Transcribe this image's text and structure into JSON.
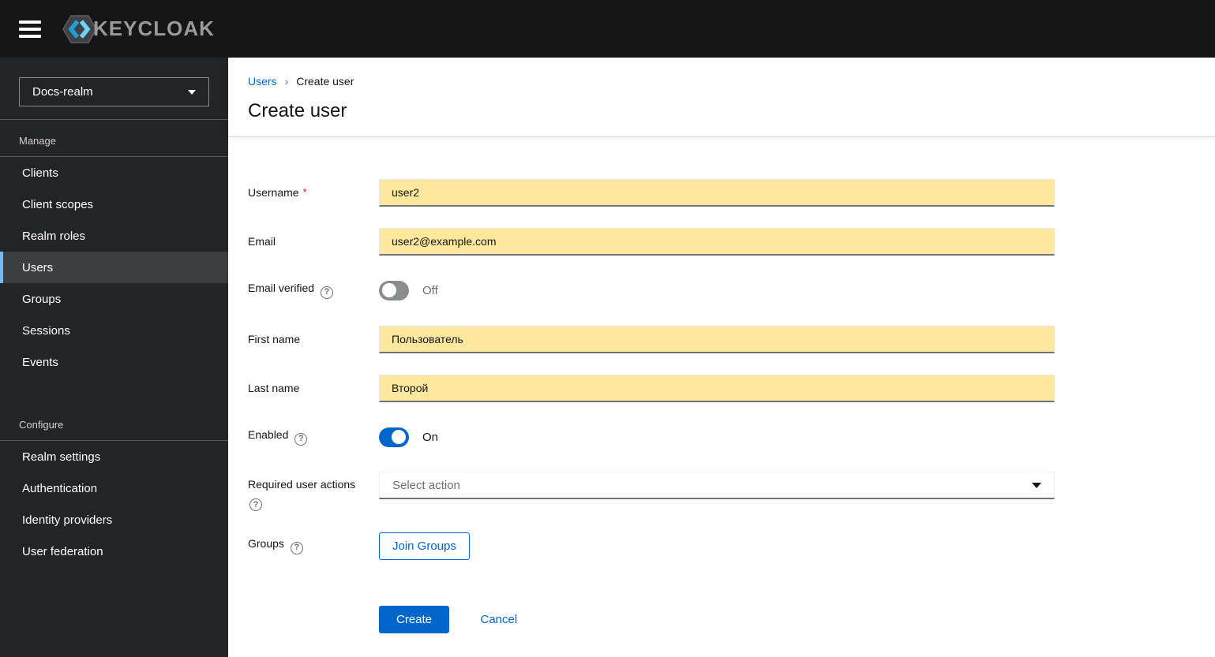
{
  "topbar": {
    "logo_text": "KEYCLOAK"
  },
  "icons": {
    "help": "?",
    "breadcrumb_separator": "›"
  },
  "sidebar": {
    "realm_selector": {
      "label": "Docs-realm"
    },
    "sections": [
      {
        "header": "Manage",
        "items": [
          {
            "label": "Clients"
          },
          {
            "label": "Client scopes"
          },
          {
            "label": "Realm roles"
          },
          {
            "label": "Users"
          },
          {
            "label": "Groups"
          },
          {
            "label": "Sessions"
          },
          {
            "label": "Events"
          }
        ]
      },
      {
        "header": "Configure",
        "items": [
          {
            "label": "Realm settings"
          },
          {
            "label": "Authentication"
          },
          {
            "label": "Identity providers"
          },
          {
            "label": "User federation"
          }
        ]
      }
    ]
  },
  "breadcrumb": {
    "items": [
      {
        "label": "Users"
      },
      {
        "label": "Create user"
      }
    ]
  },
  "page": {
    "title": "Create user"
  },
  "form": {
    "username": {
      "label": "Username",
      "required_indicator": "*",
      "value": "user2"
    },
    "email": {
      "label": "Email",
      "value": "user2@example.com"
    },
    "email_verified": {
      "label": "Email verified",
      "state": "Off"
    },
    "first_name": {
      "label": "First name",
      "value": "Пользователь"
    },
    "last_name": {
      "label": "Last name",
      "value": "Второй"
    },
    "enabled": {
      "label": "Enabled",
      "state": "On"
    },
    "required_user_actions": {
      "label": "Required user actions",
      "placeholder": "Select action"
    },
    "groups": {
      "label": "Groups",
      "button_label": "Join Groups"
    },
    "actions": {
      "create_label": "Create",
      "cancel_label": "Cancel"
    }
  },
  "colors": {
    "accent_blue": "#0066cc",
    "autofill_yellow": "#fde89e",
    "topbar_bg": "#151618",
    "sidebar_bg": "#212428",
    "active_item_bg": "#3c3f42",
    "active_item_border": "#73bcf7",
    "toggle_off": "#8a8d90",
    "required_red": "#c9190b"
  }
}
